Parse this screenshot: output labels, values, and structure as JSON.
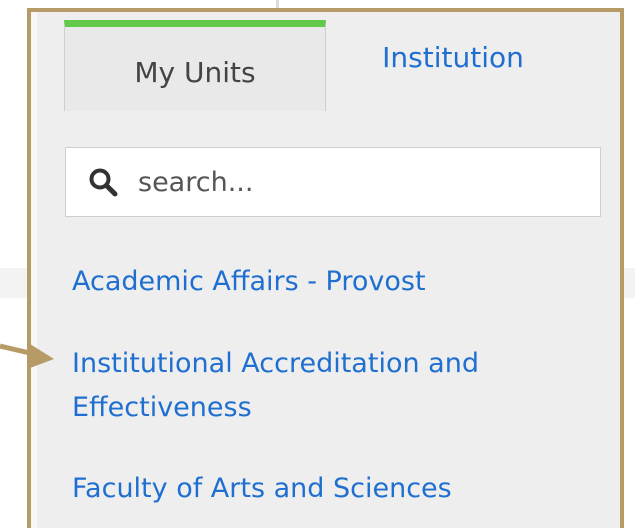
{
  "tabs": {
    "my_units": "My Units",
    "institution": "Institution"
  },
  "search": {
    "placeholder": "search..."
  },
  "units": [
    "Academic Affairs - Provost",
    "Institutional Accreditation and Effectiveness",
    "Faculty of Arts and Sciences"
  ],
  "colors": {
    "panel_border": "#b79b67",
    "active_tab_accent": "#62c94a",
    "link": "#1f6fd1",
    "panel_background": "#eeeeee"
  },
  "icons": {
    "search": "search-icon",
    "annotation": "pointer-arrow-icon"
  }
}
